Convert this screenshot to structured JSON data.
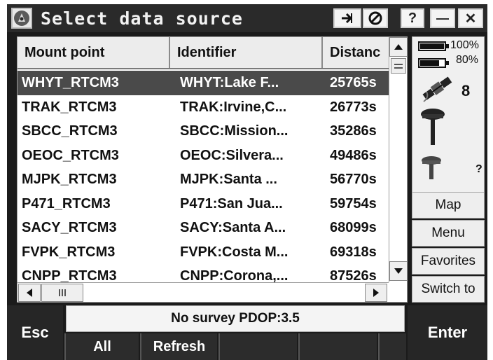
{
  "window": {
    "title": "Select data source",
    "buttons": {
      "connect_icon": "connect-arrow-icon",
      "disconnect_icon": "no-entry-icon",
      "help_label": "?",
      "minimize_label": "—",
      "close_label": "✕"
    }
  },
  "table": {
    "columns": [
      "Mount point",
      "Identifier",
      "Distanc"
    ],
    "rows": [
      {
        "mount": "WHYT_RTCM3",
        "id": "WHYT:Lake F...",
        "dist": "25765s"
      },
      {
        "mount": "TRAK_RTCM3",
        "id": "TRAK:Irvine,C...",
        "dist": "26773s"
      },
      {
        "mount": "SBCC_RTCM3",
        "id": "SBCC:Mission...",
        "dist": "35286s"
      },
      {
        "mount": "OEOC_RTCM3",
        "id": "OEOC:Silvera...",
        "dist": "49486s"
      },
      {
        "mount": "MJPK_RTCM3",
        "id": "MJPK:Santa ...",
        "dist": "56770s"
      },
      {
        "mount": "P471_RTCM3",
        "id": "P471:San Jua...",
        "dist": "59754s"
      },
      {
        "mount": "SACY_RTCM3",
        "id": "SACY:Santa A...",
        "dist": "68099s"
      },
      {
        "mount": "FVPK_RTCM3",
        "id": "FVPK:Costa M...",
        "dist": "69318s"
      },
      {
        "mount": "CNPP_RTCM3",
        "id": "CNPP:Corona,...",
        "dist": "87526s"
      }
    ],
    "selected_row": "WHYT_RTCM3"
  },
  "status_panel": {
    "battery1": "100%",
    "battery2": "80%",
    "battery1_level": 1.0,
    "battery2_level": 0.8,
    "satellites": "8",
    "receiver2_status": "?"
  },
  "side_buttons": {
    "map": "Map",
    "menu": "Menu",
    "favorites": "Favorites",
    "switch_to": "Switch to"
  },
  "bottom": {
    "status": "No survey  PDOP:3.5",
    "esc": "Esc",
    "enter": "Enter",
    "softkeys": [
      "All",
      "Refresh",
      "",
      "",
      ""
    ]
  },
  "colors": {
    "selected_row_bg": "#4a4a4a",
    "frame_bg": "#1b1b1b"
  }
}
